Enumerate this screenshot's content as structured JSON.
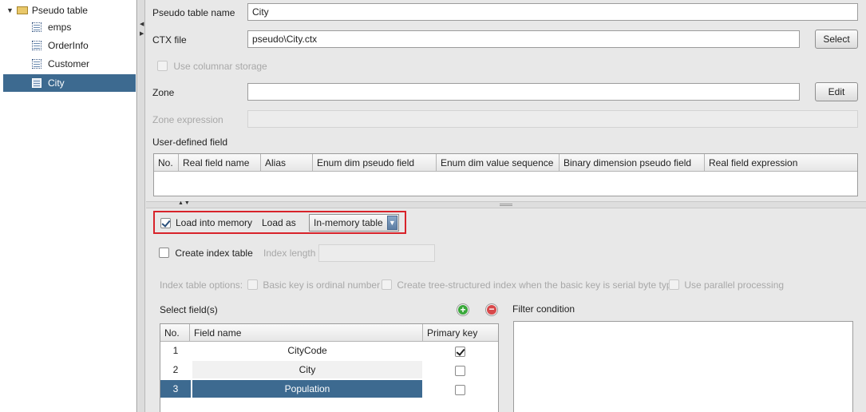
{
  "tree": {
    "root": "Pseudo table",
    "items": [
      "emps",
      "OrderInfo",
      "Customer",
      "City"
    ],
    "selected": "City"
  },
  "form": {
    "pseudo_table_name_label": "Pseudo table name",
    "pseudo_table_name_value": "City",
    "ctx_file_label": "CTX file",
    "ctx_file_value": "pseudo\\City.ctx",
    "select_button": "Select",
    "use_columnar_label": "Use columnar storage",
    "zone_label": "Zone",
    "zone_value": "",
    "edit_button": "Edit",
    "zone_expression_label": "Zone expression",
    "user_defined_field_label": "User-defined field",
    "udf_columns": [
      "No.",
      "Real field name",
      "Alias",
      "Enum dim pseudo field",
      "Enum dim value sequence",
      "Binary dimension pseudo field",
      "Real field expression"
    ]
  },
  "memory": {
    "load_into_memory_label": "Load into memory",
    "load_as_label": "Load as",
    "load_as_value": "In-memory table",
    "create_index_label": "Create index table",
    "index_length_label": "Index length",
    "index_options_label": "Index table options:",
    "opt_basic_key": "Basic key is ordinal number",
    "opt_tree_index": "Create tree-structured index when the basic key is serial byte type",
    "opt_parallel": "Use parallel processing"
  },
  "fields": {
    "select_fields_label": "Select field(s)",
    "filter_condition_label": "Filter condition",
    "columns": [
      "No.",
      "Field name",
      "Primary key"
    ],
    "rows": [
      {
        "no": "1",
        "name": "CityCode",
        "primary": true
      },
      {
        "no": "2",
        "name": "City",
        "primary": false
      },
      {
        "no": "3",
        "name": "Population",
        "primary": false
      }
    ]
  },
  "colors": {
    "selection": "#3d6a90",
    "highlight_border": "#d8232a"
  }
}
